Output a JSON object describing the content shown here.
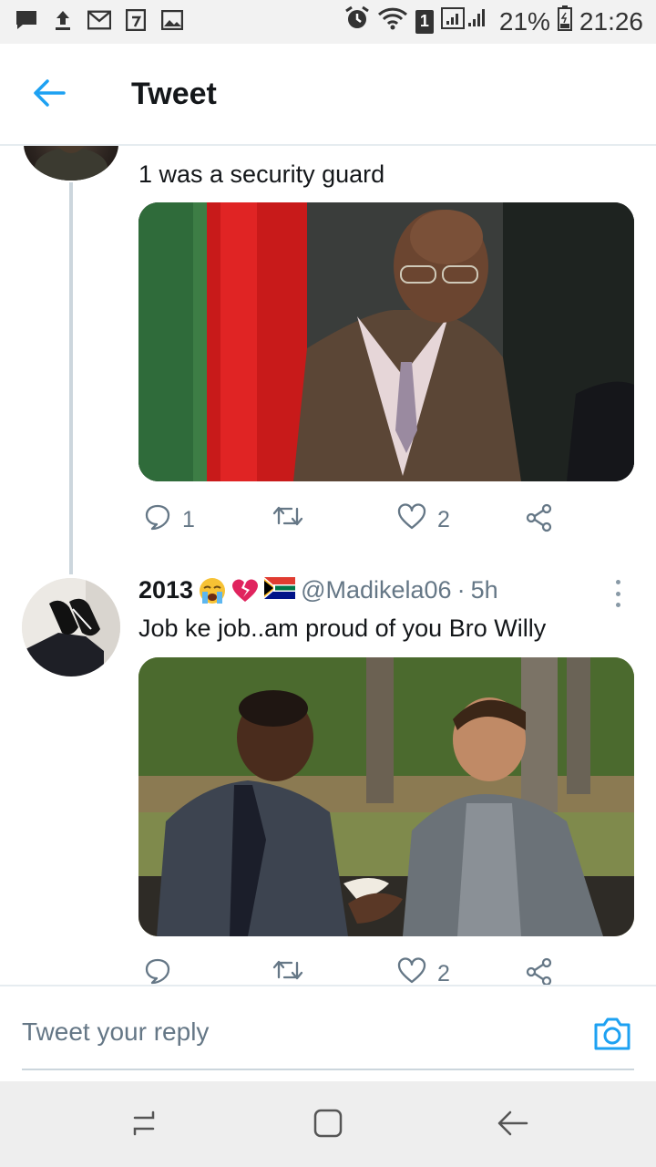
{
  "status_bar": {
    "battery_percent": "21%",
    "time": "21:26",
    "sim_badge": "1",
    "left_icons": [
      "message-icon",
      "upload-icon",
      "gmail-icon",
      "calendar-icon",
      "gallery-icon"
    ],
    "right_icons": [
      "alarm-icon",
      "wifi-icon",
      "signal-icon",
      "battery-icon"
    ]
  },
  "app_bar": {
    "title": "Tweet",
    "back_icon": "arrow-left-icon",
    "accent_color": "#1da1f2"
  },
  "tweets": [
    {
      "text": "1 was a security guard",
      "media_description_icon": "photo",
      "replies": "1",
      "retweets": "",
      "likes": "2"
    },
    {
      "display_name": "2013",
      "emojis": [
        "crying-face-emoji",
        "broken-heart-emoji",
        "south-africa-flag-emoji"
      ],
      "handle": "@Madikela06",
      "separator": "·",
      "time": "5h",
      "text": "Job ke job..am proud of you Bro Willy",
      "replies": "",
      "retweets": "",
      "likes": "2"
    }
  ],
  "reply_bar": {
    "placeholder": "Tweet your reply",
    "camera_icon": "camera-icon"
  },
  "nav_bar": {
    "icons": [
      "recent-apps-icon",
      "home-icon",
      "back-icon"
    ]
  }
}
